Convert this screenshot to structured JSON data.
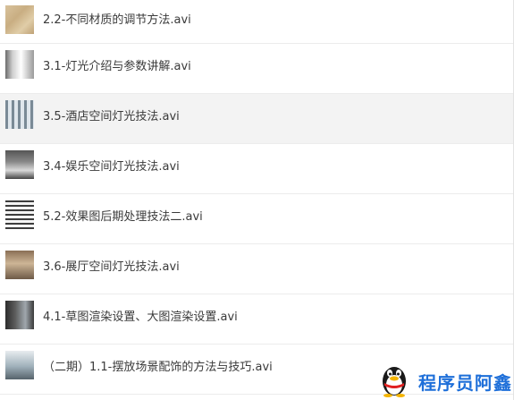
{
  "files": [
    {
      "name": "2.2-不同材质的调节方法.avi",
      "thumb": "texture-thumbnail"
    },
    {
      "name": "3.1-灯光介绍与参数讲解.avi",
      "thumb": "room-thumbnail"
    },
    {
      "name": "3.5-酒店空间灯光技法.avi",
      "thumb": "hotel-thumbnail",
      "selected": true
    },
    {
      "name": "3.4-娱乐空间灯光技法.avi",
      "thumb": "entertainment-thumbnail"
    },
    {
      "name": "5.2-效果图后期处理技法二.avi",
      "thumb": "postprocess-thumbnail"
    },
    {
      "name": "3.6-展厅空间灯光技法.avi",
      "thumb": "hall-thumbnail"
    },
    {
      "name": "4.1-草图渲染设置、大图渲染设置.avi",
      "thumb": "render-thumbnail"
    },
    {
      "name": "（二期）1.1-摆放场景配饰的方法与技巧.avi",
      "thumb": "scene-thumbnail"
    }
  ],
  "watermark": {
    "text": "程序员阿鑫",
    "icon": "qq-penguin-icon",
    "color": "#1e6fd9"
  }
}
